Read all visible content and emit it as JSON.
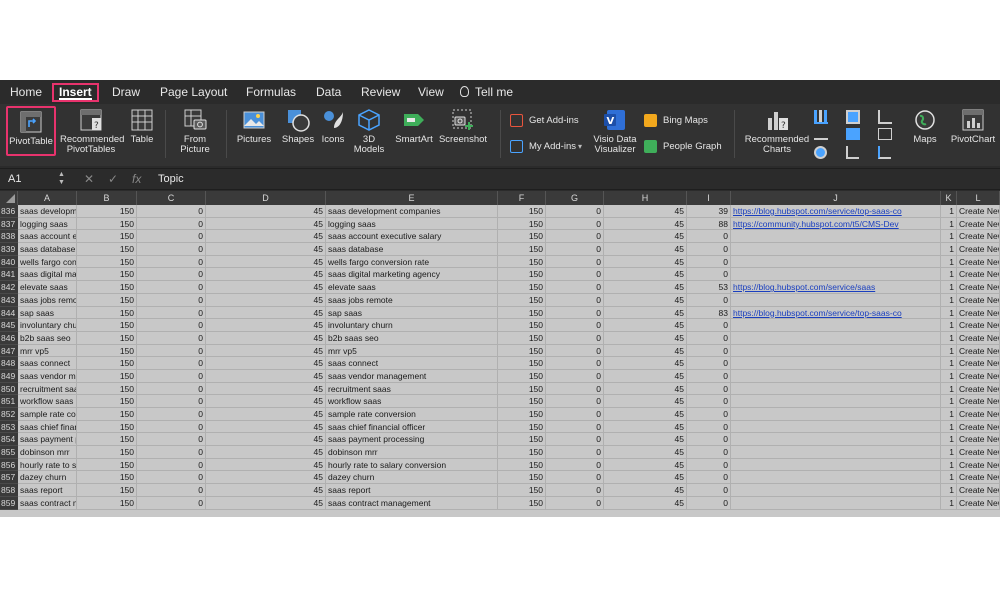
{
  "tabs": [
    "Home",
    "Insert",
    "Draw",
    "Page Layout",
    "Formulas",
    "Data",
    "Review",
    "View",
    "Tell me"
  ],
  "active_tab": "Insert",
  "ribbon": {
    "pivot_table": "PivotTable",
    "recommended_pivot_1": "Recommended",
    "recommended_pivot_2": "PivotTables",
    "table": "Table",
    "from_picture_1": "From",
    "from_picture_2": "Picture",
    "pictures": "Pictures",
    "shapes": "Shapes",
    "icons": "Icons",
    "models_1": "3D",
    "models_2": "Models",
    "smartart": "SmartArt",
    "screenshot": "Screenshot",
    "get_addins": "Get Add-ins",
    "my_addins": "My Add-ins",
    "visio_1": "Visio Data",
    "visio_2": "Visualizer",
    "bing_maps": "Bing Maps",
    "people_graph": "People Graph",
    "rec_charts_1": "Recommended",
    "rec_charts_2": "Charts",
    "maps": "Maps",
    "pivotchart": "PivotChart"
  },
  "formula_bar": {
    "name_box": "A1",
    "fx": "fx",
    "content": "Topic"
  },
  "columns": [
    "A",
    "B",
    "C",
    "D",
    "E",
    "F",
    "G",
    "H",
    "I",
    "J",
    "K",
    "L"
  ],
  "rows": [
    {
      "n": "836",
      "a": "saas developme",
      "b": "150",
      "c": "0",
      "d": "45",
      "e": "saas development companies",
      "f": "150",
      "g": "0",
      "h": "45",
      "i": "39",
      "j": "https://blog.hubspot.com/service/top-saas-co",
      "k": "1",
      "l": "Create New"
    },
    {
      "n": "837",
      "a": "logging saas",
      "b": "150",
      "c": "0",
      "d": "45",
      "e": "logging saas",
      "f": "150",
      "g": "0",
      "h": "45",
      "i": "88",
      "j": "https://community.hubspot.com/t5/CMS-Dev",
      "k": "1",
      "l": "Create New"
    },
    {
      "n": "838",
      "a": "saas account ex",
      "b": "150",
      "c": "0",
      "d": "45",
      "e": "saas account executive salary",
      "f": "150",
      "g": "0",
      "h": "45",
      "i": "0",
      "j": "",
      "k": "1",
      "l": "Create New"
    },
    {
      "n": "839",
      "a": "saas database",
      "b": "150",
      "c": "0",
      "d": "45",
      "e": "saas database",
      "f": "150",
      "g": "0",
      "h": "45",
      "i": "0",
      "j": "",
      "k": "1",
      "l": "Create New"
    },
    {
      "n": "840",
      "a": "wells fargo con",
      "b": "150",
      "c": "0",
      "d": "45",
      "e": "wells fargo conversion rate",
      "f": "150",
      "g": "0",
      "h": "45",
      "i": "0",
      "j": "",
      "k": "1",
      "l": "Create New"
    },
    {
      "n": "841",
      "a": "saas digital mar",
      "b": "150",
      "c": "0",
      "d": "45",
      "e": "saas digital marketing agency",
      "f": "150",
      "g": "0",
      "h": "45",
      "i": "0",
      "j": "",
      "k": "1",
      "l": "Create New"
    },
    {
      "n": "842",
      "a": "elevate saas",
      "b": "150",
      "c": "0",
      "d": "45",
      "e": "elevate saas",
      "f": "150",
      "g": "0",
      "h": "45",
      "i": "53",
      "j": "https://blog.hubspot.com/service/saas",
      "k": "1",
      "l": "Create New"
    },
    {
      "n": "843",
      "a": "saas jobs remot",
      "b": "150",
      "c": "0",
      "d": "45",
      "e": "saas jobs remote",
      "f": "150",
      "g": "0",
      "h": "45",
      "i": "0",
      "j": "",
      "k": "1",
      "l": "Create New"
    },
    {
      "n": "844",
      "a": "sap saas",
      "b": "150",
      "c": "0",
      "d": "45",
      "e": "sap saas",
      "f": "150",
      "g": "0",
      "h": "45",
      "i": "83",
      "j": "https://blog.hubspot.com/service/top-saas-co",
      "k": "1",
      "l": "Create New"
    },
    {
      "n": "845",
      "a": "involuntary chu",
      "b": "150",
      "c": "0",
      "d": "45",
      "e": "involuntary churn",
      "f": "150",
      "g": "0",
      "h": "45",
      "i": "0",
      "j": "",
      "k": "1",
      "l": "Create New"
    },
    {
      "n": "846",
      "a": "b2b saas seo",
      "b": "150",
      "c": "0",
      "d": "45",
      "e": "b2b saas seo",
      "f": "150",
      "g": "0",
      "h": "45",
      "i": "0",
      "j": "",
      "k": "1",
      "l": "Create New"
    },
    {
      "n": "847",
      "a": "mrr vp5",
      "b": "150",
      "c": "0",
      "d": "45",
      "e": "mrr vp5",
      "f": "150",
      "g": "0",
      "h": "45",
      "i": "0",
      "j": "",
      "k": "1",
      "l": "Create New"
    },
    {
      "n": "848",
      "a": "saas connect",
      "b": "150",
      "c": "0",
      "d": "45",
      "e": "saas connect",
      "f": "150",
      "g": "0",
      "h": "45",
      "i": "0",
      "j": "",
      "k": "1",
      "l": "Create New"
    },
    {
      "n": "849",
      "a": "saas vendor ma",
      "b": "150",
      "c": "0",
      "d": "45",
      "e": "saas vendor management",
      "f": "150",
      "g": "0",
      "h": "45",
      "i": "0",
      "j": "",
      "k": "1",
      "l": "Create New"
    },
    {
      "n": "850",
      "a": "recruitment saa",
      "b": "150",
      "c": "0",
      "d": "45",
      "e": "recruitment saas",
      "f": "150",
      "g": "0",
      "h": "45",
      "i": "0",
      "j": "",
      "k": "1",
      "l": "Create New"
    },
    {
      "n": "851",
      "a": "workflow saas",
      "b": "150",
      "c": "0",
      "d": "45",
      "e": "workflow saas",
      "f": "150",
      "g": "0",
      "h": "45",
      "i": "0",
      "j": "",
      "k": "1",
      "l": "Create New"
    },
    {
      "n": "852",
      "a": "sample rate cor",
      "b": "150",
      "c": "0",
      "d": "45",
      "e": "sample rate conversion",
      "f": "150",
      "g": "0",
      "h": "45",
      "i": "0",
      "j": "",
      "k": "1",
      "l": "Create New"
    },
    {
      "n": "853",
      "a": "saas chief finan",
      "b": "150",
      "c": "0",
      "d": "45",
      "e": "saas chief financial officer",
      "f": "150",
      "g": "0",
      "h": "45",
      "i": "0",
      "j": "",
      "k": "1",
      "l": "Create New"
    },
    {
      "n": "854",
      "a": "saas payment p",
      "b": "150",
      "c": "0",
      "d": "45",
      "e": "saas payment processing",
      "f": "150",
      "g": "0",
      "h": "45",
      "i": "0",
      "j": "",
      "k": "1",
      "l": "Create New"
    },
    {
      "n": "855",
      "a": "dobinson mrr",
      "b": "150",
      "c": "0",
      "d": "45",
      "e": "dobinson mrr",
      "f": "150",
      "g": "0",
      "h": "45",
      "i": "0",
      "j": "",
      "k": "1",
      "l": "Create New"
    },
    {
      "n": "856",
      "a": "hourly rate to s",
      "b": "150",
      "c": "0",
      "d": "45",
      "e": "hourly rate to salary conversion",
      "f": "150",
      "g": "0",
      "h": "45",
      "i": "0",
      "j": "",
      "k": "1",
      "l": "Create New"
    },
    {
      "n": "857",
      "a": "dazey churn",
      "b": "150",
      "c": "0",
      "d": "45",
      "e": "dazey churn",
      "f": "150",
      "g": "0",
      "h": "45",
      "i": "0",
      "j": "",
      "k": "1",
      "l": "Create New"
    },
    {
      "n": "858",
      "a": "saas report",
      "b": "150",
      "c": "0",
      "d": "45",
      "e": "saas report",
      "f": "150",
      "g": "0",
      "h": "45",
      "i": "0",
      "j": "",
      "k": "1",
      "l": "Create New"
    },
    {
      "n": "859",
      "a": "saas contract m",
      "b": "150",
      "c": "0",
      "d": "45",
      "e": "saas contract management",
      "f": "150",
      "g": "0",
      "h": "45",
      "i": "0",
      "j": "",
      "k": "1",
      "l": "Create New"
    }
  ],
  "colors": {
    "highlight": "#e8336d",
    "ribbon_bg": "#323232",
    "grid_bg": "#c8c8c8",
    "link": "#1a3fbf"
  }
}
